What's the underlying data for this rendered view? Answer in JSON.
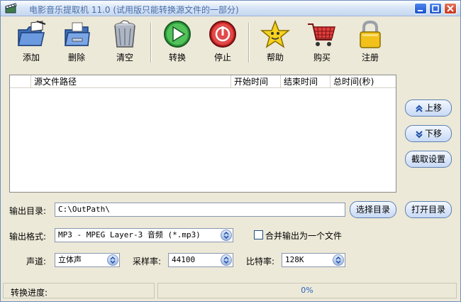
{
  "window": {
    "title": "电影音乐提取机 11.0 (试用版只能转换源文件的一部分)"
  },
  "toolbar": {
    "add_label": "添加",
    "delete_label": "删除",
    "clear_label": "清空",
    "convert_label": "转换",
    "stop_label": "停止",
    "help_label": "帮助",
    "buy_label": "购买",
    "register_label": "注册"
  },
  "file_list": {
    "columns": [
      "源文件路径",
      "开始时间",
      "结束时间",
      "总时间(秒)"
    ],
    "rows": []
  },
  "side_buttons": {
    "move_up": "上移",
    "move_down": "下移",
    "trim_settings": "截取设置"
  },
  "output": {
    "dir_label": "输出目录:",
    "dir_value": "C:\\OutPath\\",
    "choose_dir": "选择目录",
    "open_dir": "打开目录",
    "format_label": "输出格式:",
    "format_value": "MP3 - MPEG Layer-3 音频 (*.mp3)",
    "merge_label": "合并输出为一个文件",
    "merge_checked": false,
    "channel_label": "声道:",
    "channel_value": "立体声",
    "samplerate_label": "采样率:",
    "samplerate_value": "44100",
    "bitrate_label": "比特率:",
    "bitrate_value": "128K"
  },
  "status": {
    "progress_label": "转换进度:",
    "progress_percent": 0,
    "progress_text": "0%"
  },
  "colors": {
    "accent": "#3a78d8",
    "window_bg": "#ece9d8",
    "title_text": "#4a6ea9"
  }
}
